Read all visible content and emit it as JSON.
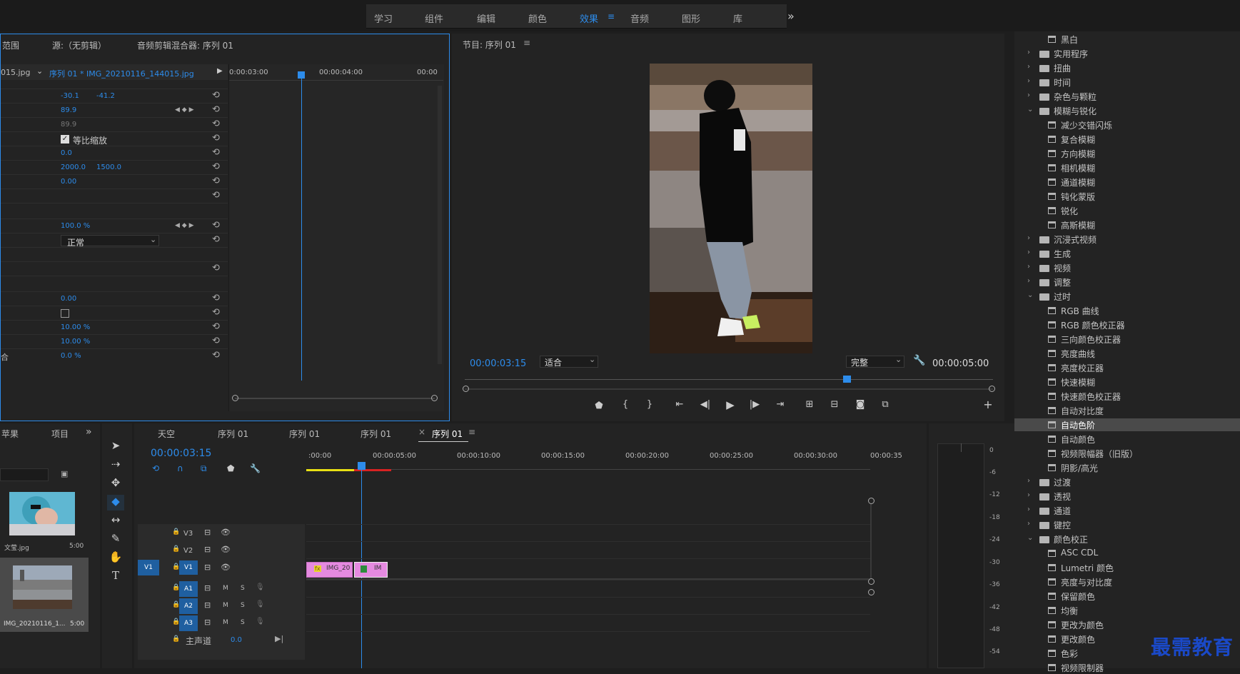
{
  "workspaces": [
    "学习",
    "组件",
    "编辑",
    "颜色",
    "效果",
    "音频",
    "图形",
    "库"
  ],
  "workspace_active": "效果",
  "overflow": "»",
  "effect_controls": {
    "tabs": [
      "范围",
      "源:（无剪辑）",
      "音频剪辑混合器: 序列 01"
    ],
    "clip_left": "015.jpg",
    "clip_right": "序列 01 * IMG_20210116_144015.jpg",
    "ruler": [
      "0:00:03:00",
      "00:00:04:00",
      "00:00"
    ],
    "rows": [
      {
        "v1": "-30.1",
        "v2": "-41.2"
      },
      {
        "v1": "89.9"
      },
      {
        "v1": "89.9"
      },
      {
        "checkbox": "等比缩放"
      },
      {
        "v1": "0.0"
      },
      {
        "v1": "2000.0",
        "v2": "1500.0"
      },
      {
        "v1": "0.00"
      },
      {
        "v1": ""
      },
      {
        "v1": "100.0 %"
      },
      {
        "select": "正常"
      },
      {
        "v1": "0.00"
      },
      {
        "v1": "10.00 %"
      },
      {
        "v1": "10.00 %"
      },
      {
        "v1": "0.0 %"
      }
    ],
    "row_left_glyph": "合"
  },
  "program": {
    "title": "节目: 序列 01",
    "timecode": "00:00:03:15",
    "fit": "适合",
    "quality": "完整",
    "duration": "00:00:05:00"
  },
  "project": {
    "tabs": [
      "苹果",
      "项目"
    ],
    "items": [
      {
        "name": "文莹.jpg",
        "dur": "5:00"
      },
      {
        "name": "IMG_20210116_1...",
        "dur": "5:00"
      }
    ]
  },
  "timeline": {
    "tabs": [
      "天空",
      "序列 01",
      "序列 01",
      "序列 01",
      "序列 01"
    ],
    "timecode": "00:00:03:15",
    "ruler": [
      ":00:00",
      "00:00:05:00",
      "00:00:10:00",
      "00:00:15:00",
      "00:00:20:00",
      "00:00:25:00",
      "00:00:30:00",
      "00:00:35"
    ],
    "video_tracks": [
      "V3",
      "V2",
      "V1"
    ],
    "audio_tracks": [
      "A1",
      "A2",
      "A3"
    ],
    "master": "主声道",
    "master_val": "0.0",
    "clip1": "IMG_20",
    "clip2": "IM",
    "ms": [
      "M",
      "S"
    ]
  },
  "meter_labels": [
    "0",
    "-6",
    "-12",
    "-18",
    "-24",
    "-30",
    "-36",
    "-42",
    "-48",
    "-54"
  ],
  "effects_tree": [
    {
      "t": "黑白",
      "k": "fx"
    },
    {
      "t": "实用程序",
      "k": "folder"
    },
    {
      "t": "扭曲",
      "k": "folder"
    },
    {
      "t": "时间",
      "k": "folder"
    },
    {
      "t": "杂色与颗粒",
      "k": "folder"
    },
    {
      "t": "模糊与锐化",
      "k": "open"
    },
    {
      "t": "减少交错闪烁",
      "k": "fx"
    },
    {
      "t": "复合模糊",
      "k": "fx"
    },
    {
      "t": "方向模糊",
      "k": "fx"
    },
    {
      "t": "相机模糊",
      "k": "fx"
    },
    {
      "t": "通道模糊",
      "k": "fx"
    },
    {
      "t": "钝化蒙版",
      "k": "fx"
    },
    {
      "t": "锐化",
      "k": "fx"
    },
    {
      "t": "高斯模糊",
      "k": "fx"
    },
    {
      "t": "沉浸式视频",
      "k": "folder"
    },
    {
      "t": "生成",
      "k": "folder"
    },
    {
      "t": "视频",
      "k": "folder"
    },
    {
      "t": "调整",
      "k": "folder"
    },
    {
      "t": "过时",
      "k": "open"
    },
    {
      "t": "RGB 曲线",
      "k": "fx"
    },
    {
      "t": "RGB 颜色校正器",
      "k": "fx"
    },
    {
      "t": "三向颜色校正器",
      "k": "fx"
    },
    {
      "t": "亮度曲线",
      "k": "fx"
    },
    {
      "t": "亮度校正器",
      "k": "fx"
    },
    {
      "t": "快速模糊",
      "k": "fx"
    },
    {
      "t": "快速颜色校正器",
      "k": "fx"
    },
    {
      "t": "自动对比度",
      "k": "fx"
    },
    {
      "t": "自动色阶",
      "k": "fx",
      "sel": true
    },
    {
      "t": "自动颜色",
      "k": "fx"
    },
    {
      "t": "视频限幅器（旧版）",
      "k": "fx"
    },
    {
      "t": "阴影/高光",
      "k": "fx"
    },
    {
      "t": "过渡",
      "k": "folder"
    },
    {
      "t": "透视",
      "k": "folder"
    },
    {
      "t": "通道",
      "k": "folder"
    },
    {
      "t": "键控",
      "k": "folder"
    },
    {
      "t": "颜色校正",
      "k": "open"
    },
    {
      "t": "ASC CDL",
      "k": "fx"
    },
    {
      "t": "Lumetri 颜色",
      "k": "fx"
    },
    {
      "t": "亮度与对比度",
      "k": "fx"
    },
    {
      "t": "保留颜色",
      "k": "fx"
    },
    {
      "t": "均衡",
      "k": "fx"
    },
    {
      "t": "更改为颜色",
      "k": "fx"
    },
    {
      "t": "更改颜色",
      "k": "fx"
    },
    {
      "t": "色彩",
      "k": "fx"
    },
    {
      "t": "视频限制器",
      "k": "fx"
    }
  ],
  "watermark": "最需教育"
}
